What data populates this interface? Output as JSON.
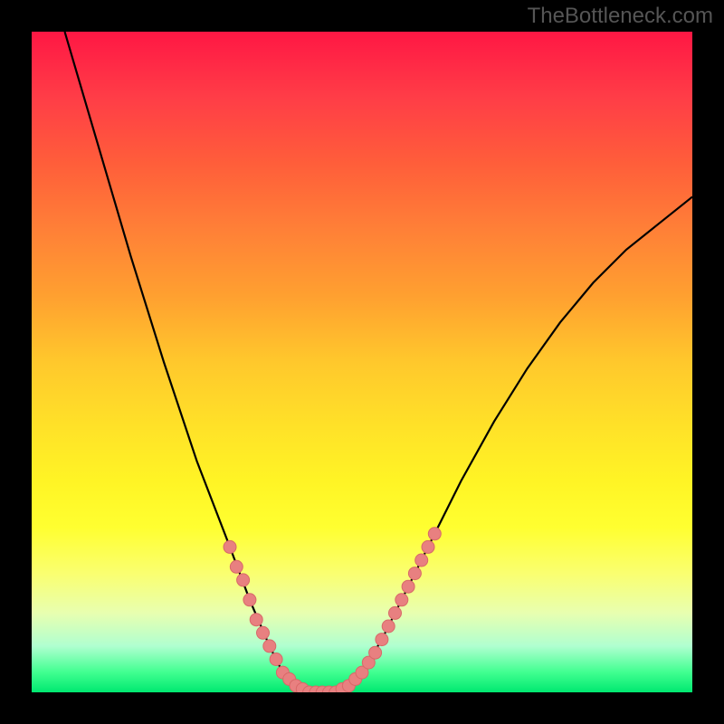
{
  "watermark": "TheBottleneck.com",
  "chart_data": {
    "type": "line",
    "title": "",
    "xlabel": "",
    "ylabel": "",
    "xlim": [
      0,
      100
    ],
    "ylim": [
      0,
      100
    ],
    "gradient_stops": [
      {
        "pos": 0,
        "color": "#ff1744"
      },
      {
        "pos": 50,
        "color": "#ffc82c"
      },
      {
        "pos": 75,
        "color": "#ffff30"
      },
      {
        "pos": 97,
        "color": "#40ff90"
      },
      {
        "pos": 100,
        "color": "#00e870"
      }
    ],
    "curve_points": [
      {
        "x": 5,
        "y": 100
      },
      {
        "x": 10,
        "y": 83
      },
      {
        "x": 15,
        "y": 66
      },
      {
        "x": 20,
        "y": 50
      },
      {
        "x": 25,
        "y": 35
      },
      {
        "x": 30,
        "y": 22
      },
      {
        "x": 33,
        "y": 14
      },
      {
        "x": 36,
        "y": 7
      },
      {
        "x": 38,
        "y": 3
      },
      {
        "x": 40,
        "y": 1
      },
      {
        "x": 42,
        "y": 0
      },
      {
        "x": 44,
        "y": 0
      },
      {
        "x": 46,
        "y": 0
      },
      {
        "x": 48,
        "y": 1
      },
      {
        "x": 50,
        "y": 3
      },
      {
        "x": 53,
        "y": 8
      },
      {
        "x": 56,
        "y": 14
      },
      {
        "x": 60,
        "y": 22
      },
      {
        "x": 65,
        "y": 32
      },
      {
        "x": 70,
        "y": 41
      },
      {
        "x": 75,
        "y": 49
      },
      {
        "x": 80,
        "y": 56
      },
      {
        "x": 85,
        "y": 62
      },
      {
        "x": 90,
        "y": 67
      },
      {
        "x": 95,
        "y": 71
      },
      {
        "x": 100,
        "y": 75
      }
    ],
    "markers": [
      {
        "x": 30,
        "y": 22
      },
      {
        "x": 31,
        "y": 19
      },
      {
        "x": 32,
        "y": 17
      },
      {
        "x": 33,
        "y": 14
      },
      {
        "x": 34,
        "y": 11
      },
      {
        "x": 35,
        "y": 9
      },
      {
        "x": 36,
        "y": 7
      },
      {
        "x": 37,
        "y": 5
      },
      {
        "x": 38,
        "y": 3
      },
      {
        "x": 39,
        "y": 2
      },
      {
        "x": 40,
        "y": 1
      },
      {
        "x": 41,
        "y": 0.5
      },
      {
        "x": 42,
        "y": 0
      },
      {
        "x": 43,
        "y": 0
      },
      {
        "x": 44,
        "y": 0
      },
      {
        "x": 45,
        "y": 0
      },
      {
        "x": 46,
        "y": 0
      },
      {
        "x": 47,
        "y": 0.5
      },
      {
        "x": 48,
        "y": 1
      },
      {
        "x": 49,
        "y": 2
      },
      {
        "x": 50,
        "y": 3
      },
      {
        "x": 51,
        "y": 4.5
      },
      {
        "x": 52,
        "y": 6
      },
      {
        "x": 53,
        "y": 8
      },
      {
        "x": 54,
        "y": 10
      },
      {
        "x": 55,
        "y": 12
      },
      {
        "x": 56,
        "y": 14
      },
      {
        "x": 57,
        "y": 16
      },
      {
        "x": 58,
        "y": 18
      },
      {
        "x": 59,
        "y": 20
      },
      {
        "x": 60,
        "y": 22
      },
      {
        "x": 61,
        "y": 24
      }
    ]
  }
}
